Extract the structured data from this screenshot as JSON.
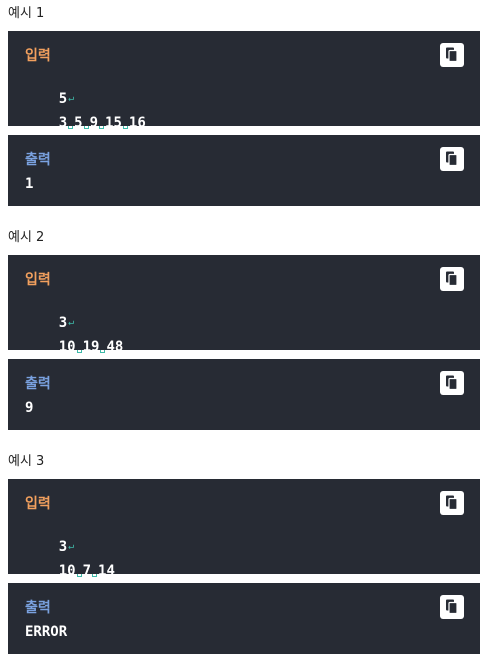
{
  "examples": [
    {
      "title": "예시 1",
      "input_label": "입력",
      "input_lines": [
        [
          "5"
        ],
        [
          "3",
          "5",
          "9",
          "15",
          "16"
        ]
      ],
      "output_label": "출력",
      "output_lines": [
        "1"
      ]
    },
    {
      "title": "예시 2",
      "input_label": "입력",
      "input_lines": [
        [
          "3"
        ],
        [
          "10",
          "19",
          "48"
        ]
      ],
      "output_label": "출력",
      "output_lines": [
        "9"
      ]
    },
    {
      "title": "예시 3",
      "input_label": "입력",
      "input_lines": [
        [
          "3"
        ],
        [
          "10",
          "7",
          "14"
        ]
      ],
      "output_label": "출력",
      "output_lines": [
        "ERROR"
      ]
    }
  ],
  "icons": {
    "copy": "copy-icon",
    "space_marker": "space-marker-icon",
    "newline_marker": "newline-marker-icon"
  },
  "colors": {
    "block_bg": "#272b34",
    "input_label": "#f2a05e",
    "output_label": "#7aa2e0",
    "whitespace_marker": "#3fb9a8"
  }
}
